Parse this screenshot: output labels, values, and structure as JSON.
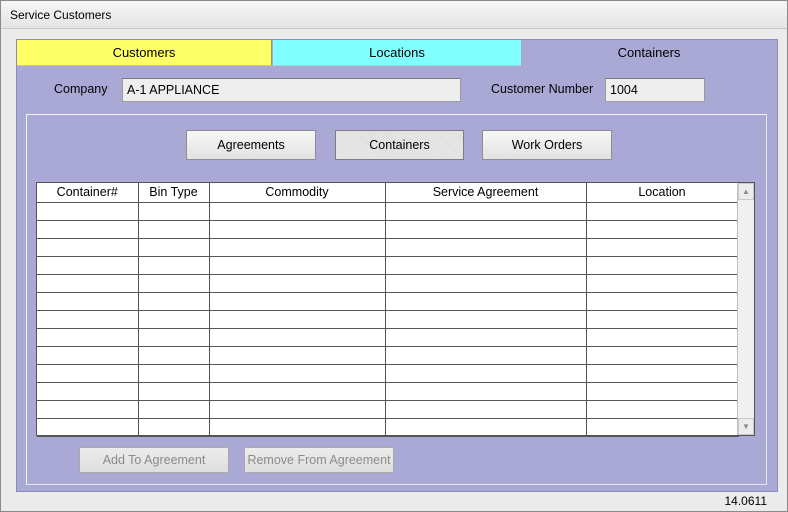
{
  "window": {
    "title": "Service Customers"
  },
  "tabs": [
    {
      "label": "Customers",
      "color": "#ffff66"
    },
    {
      "label": "Locations",
      "color": "#80ffff"
    },
    {
      "label": "Containers",
      "color": "#aaa9d6"
    }
  ],
  "form": {
    "company_label": "Company",
    "company_value": "A-1 APPLIANCE",
    "customer_number_label": "Customer Number",
    "customer_number_value": "1004"
  },
  "subnav": {
    "agreements": "Agreements",
    "containers": "Containers",
    "work_orders": "Work Orders"
  },
  "grid": {
    "columns": [
      "Container#",
      "Bin Type",
      "Commodity",
      "Service Agreement",
      "Location"
    ],
    "rows": 13
  },
  "actions": {
    "add_to_agreement": "Add To Agreement",
    "remove_from_agreement": "Remove From Agreement"
  },
  "footer": {
    "version": "14.0611"
  },
  "colors": {
    "panel": "#aaa9d6",
    "customers_tab": "#ffff66",
    "locations_tab": "#80ffff"
  }
}
